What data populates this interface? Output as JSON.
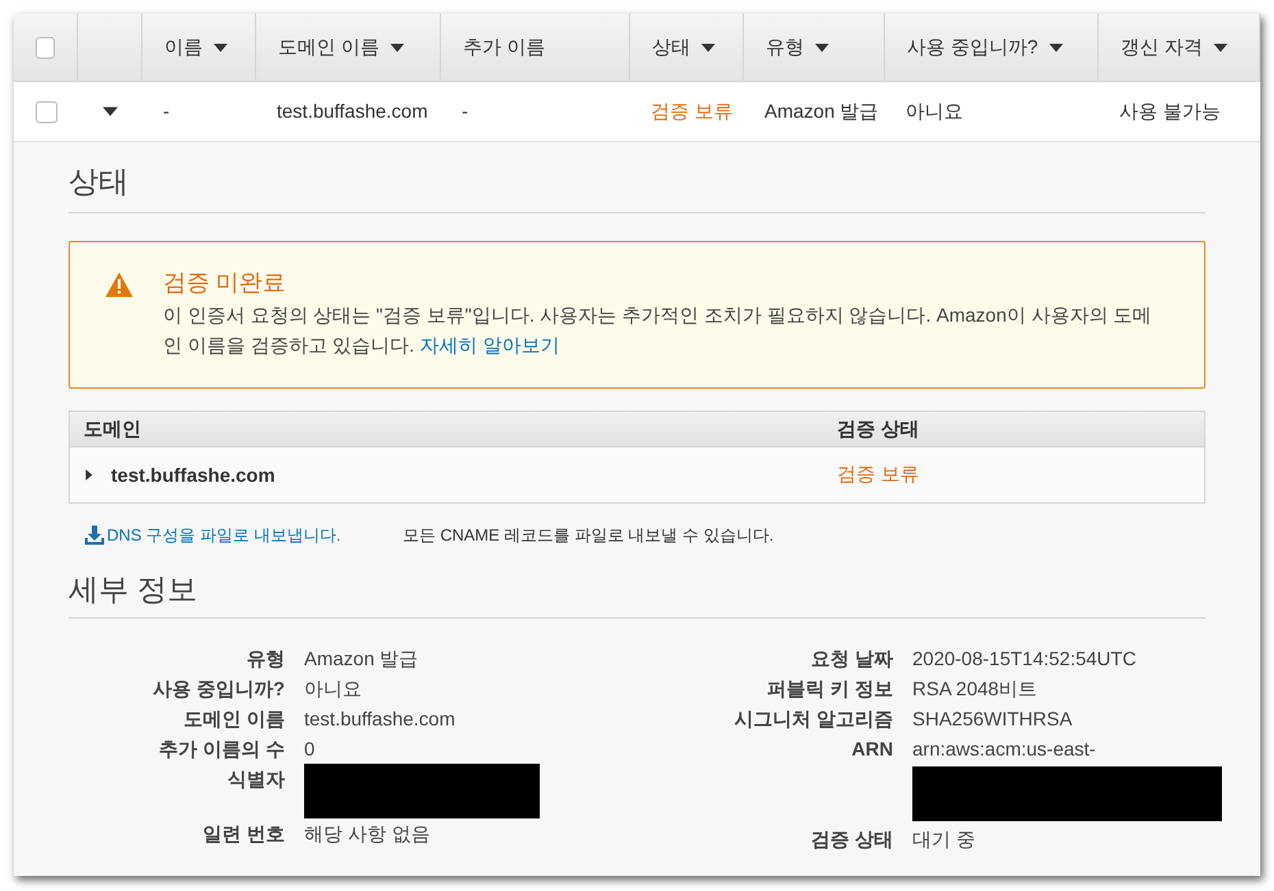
{
  "table": {
    "all_checked": false,
    "columns": [
      {
        "label": "이름",
        "sortable": true
      },
      {
        "label": "도메인 이름",
        "sortable": true
      },
      {
        "label": "추가 이름",
        "sortable": false
      },
      {
        "label": "상태",
        "sortable": true
      },
      {
        "label": "유형",
        "sortable": true
      },
      {
        "label": "사용 중입니까?",
        "sortable": true
      },
      {
        "label": "갱신 자격",
        "sortable": true
      }
    ],
    "rows": [
      {
        "checked": false,
        "expanded": true,
        "cells": [
          {
            "text": "-",
            "kind": "plain"
          },
          {
            "text": "test.buffashe.com",
            "kind": "plain"
          },
          {
            "text": "-",
            "kind": "plain"
          },
          {
            "text": "검증 보류",
            "kind": "status"
          },
          {
            "text": "Amazon 발급",
            "kind": "plain"
          },
          {
            "text": "아니요",
            "kind": "plain"
          },
          {
            "text": "사용 불가능",
            "kind": "plain"
          }
        ]
      }
    ]
  },
  "status_section": {
    "title": "상태",
    "alert": {
      "kind": "warning",
      "title": "검증 미완료",
      "message": "이 인증서 요청의 상태는 \"검증 보류\"입니다. 사용자는 추가적인 조치가 필요하지 않습니다. Amazon이 사용자의 도메인 이름을 검증하고 있습니다.",
      "link": "자세히 알아보기"
    },
    "domains": {
      "columns": [
        "도메인",
        "검증 상태"
      ],
      "rows": [
        {
          "domain": "test.buffashe.com",
          "expanded": false,
          "status": "검증 보류"
        }
      ]
    },
    "export_link": "DNS 구성을 파일로 내보냅니다.",
    "export_note": "모든 CNAME 레코드를 파일로 내보낼 수 있습니다."
  },
  "details": {
    "title": "세부 정보",
    "left": [
      {
        "label": "유형",
        "value": "Amazon 발급",
        "redacted": false
      },
      {
        "label": "사용 중입니까?",
        "value": "아니요",
        "redacted": false
      },
      {
        "label": "도메인 이름",
        "value": "test.buffashe.com",
        "redacted": false
      },
      {
        "label": "추가 이름의 수",
        "value": "0",
        "redacted": false
      },
      {
        "label": "식별자",
        "redacted": true
      },
      {
        "label": "일련 번호",
        "value": "해당 사항 없음",
        "redacted": false
      }
    ],
    "right": [
      {
        "label": "요청 날짜",
        "value": "2020-08-15T14:52:54UTC",
        "redacted": false
      },
      {
        "label": "퍼블릭 키 정보",
        "value": "RSA 2048비트",
        "redacted": false
      },
      {
        "label": "시그니처 알고리즘",
        "value": "SHA256WITHRSA",
        "redacted": false
      },
      {
        "label": "ARN",
        "value": "arn:aws:acm:us-east-",
        "redacted": true
      },
      {
        "label": "검증 상태",
        "value": "대기 중",
        "redacted": false
      }
    ]
  }
}
